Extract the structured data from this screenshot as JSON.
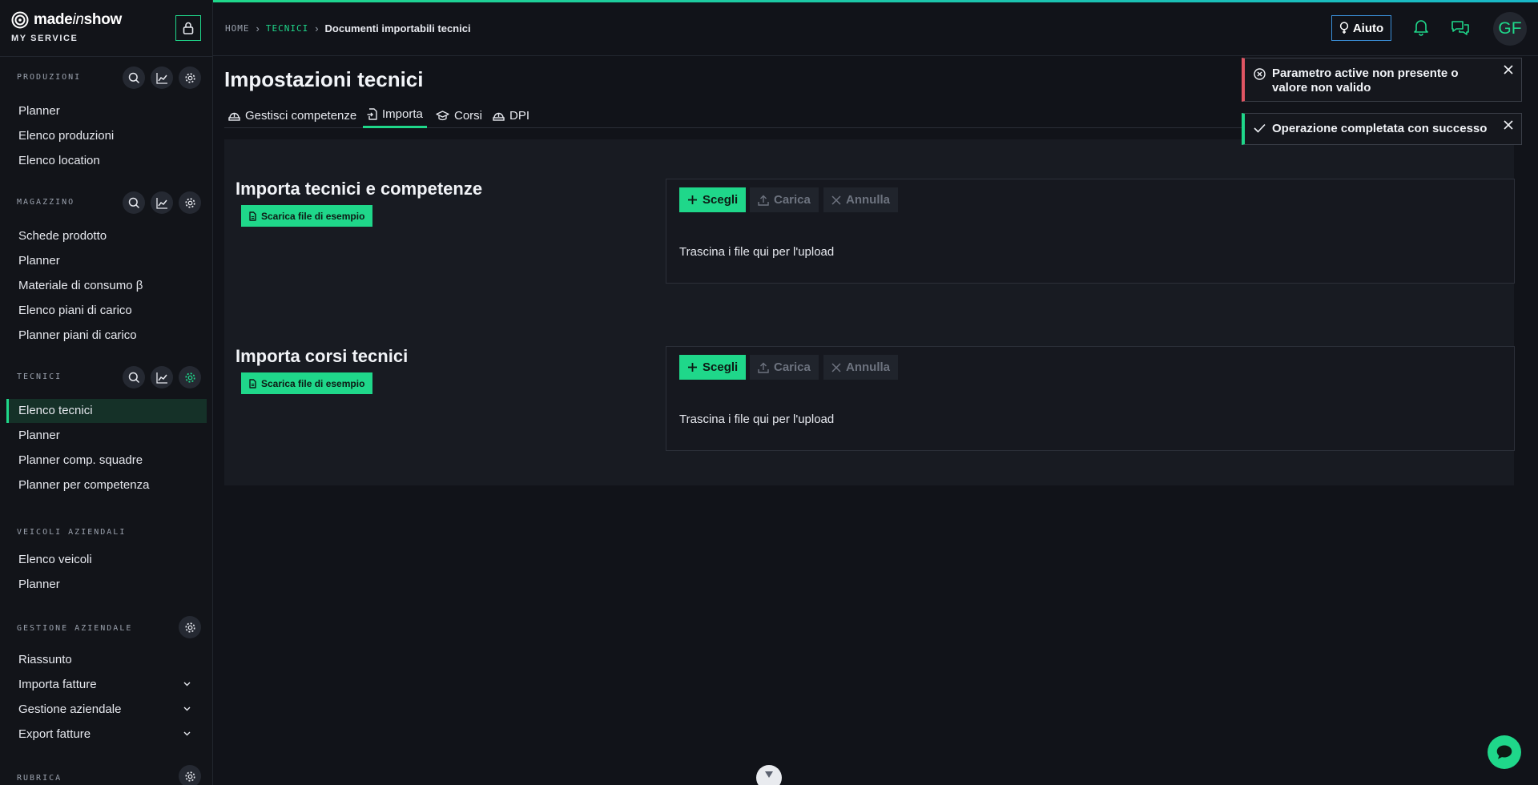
{
  "brand": {
    "name_bold": "made",
    "name_italic": "in",
    "name_end": "show",
    "subtitle": "MY SERVICE"
  },
  "sidebar": {
    "sections": [
      {
        "title": "PRODUZIONI",
        "items": [
          "Planner",
          "Elenco produzioni",
          "Elenco location"
        ]
      },
      {
        "title": "MAGAZZINO",
        "items": [
          "Schede prodotto",
          "Planner",
          "Materiale di consumo β",
          "Elenco piani di carico",
          "Planner piani di carico"
        ]
      },
      {
        "title": "TECNICI",
        "items": [
          "Elenco tecnici",
          "Planner",
          "Planner comp. squadre",
          "Planner per competenza"
        ]
      },
      {
        "title": "VEICOLI AZIENDALI",
        "items": [
          "Elenco veicoli",
          "Planner"
        ]
      },
      {
        "title": "GESTIONE AZIENDALE",
        "items": [
          "Riassunto",
          "Importa fatture",
          "Gestione aziendale",
          "Export fatture"
        ]
      },
      {
        "title": "RUBRICA"
      }
    ],
    "active_item": "Elenco tecnici"
  },
  "breadcrumb": {
    "home": "HOME",
    "section": "TECNICI",
    "current": "Documenti importabili tecnici"
  },
  "header": {
    "help_label": "Aiuto",
    "avatar_initials": "GF"
  },
  "page": {
    "title": "Impostazioni tecnici"
  },
  "tabs": [
    "Gestisci competenze",
    "Importa",
    "Corsi",
    "DPI"
  ],
  "imports": [
    {
      "title": "Importa tecnici e competenze",
      "sample_label": "Scarica file di esempio"
    },
    {
      "title": "Importa corsi tecnici",
      "sample_label": "Scarica file di esempio"
    }
  ],
  "uploader": {
    "choose_label": "Scegli",
    "upload_label": "Carica",
    "cancel_label": "Annulla",
    "drop_text": "Trascina i file qui per l'upload"
  },
  "toasts": [
    {
      "type": "error",
      "message": "Parametro active non presente o valore non valido"
    },
    {
      "type": "success",
      "message": "Operazione completata con successo"
    }
  ],
  "colors": {
    "accent": "#1fd78a",
    "error": "#e05563",
    "help_border": "#3a8fd8",
    "background": "#111319"
  }
}
